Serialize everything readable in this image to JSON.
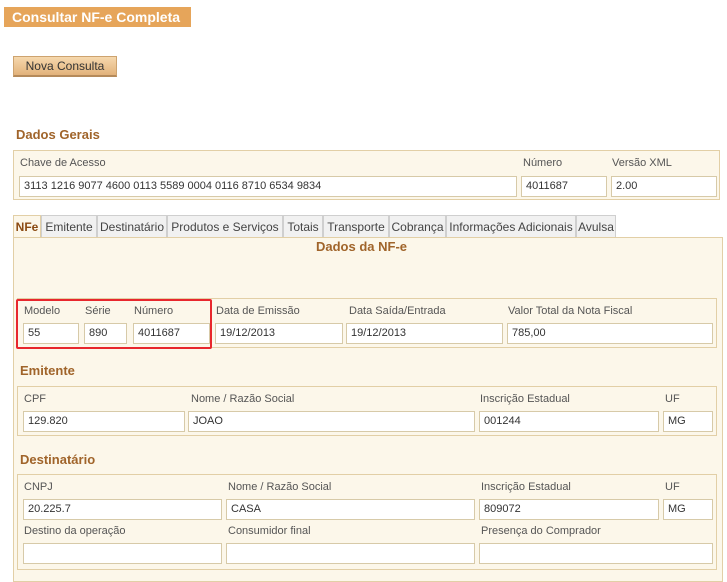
{
  "header": {
    "title": "Consultar NF-e Completa",
    "new_query_button": "Nova Consulta"
  },
  "dados_gerais": {
    "title": "Dados Gerais",
    "chave_label": "Chave de Acesso",
    "chave_value": "3113 1216 9077 4600 0113 5589 0004 0116 8710 6534 9834",
    "numero_label": "Número",
    "numero_value": "4011687",
    "versao_label": "Versão XML",
    "versao_value": "2.00"
  },
  "tabs": [
    {
      "label": "NFe"
    },
    {
      "label": "Emitente"
    },
    {
      "label": "Destinatário"
    },
    {
      "label": "Produtos e Serviços"
    },
    {
      "label": "Totais"
    },
    {
      "label": "Transporte"
    },
    {
      "label": "Cobrança"
    },
    {
      "label": "Informações Adicionais"
    },
    {
      "label": "Avulsa"
    }
  ],
  "nfe": {
    "title": "Dados da NF-e",
    "modelo_label": "Modelo",
    "modelo_value": "55",
    "serie_label": "Série",
    "serie_value": "890",
    "numero_label": "Número",
    "numero_value": "4011687",
    "emissao_label": "Data de Emissão",
    "emissao_value": "19/12/2013",
    "saida_label": "Data Saída/Entrada",
    "saida_value": "19/12/2013",
    "valor_label": "Valor Total da Nota Fiscal",
    "valor_value": "785,00"
  },
  "emitente": {
    "title": "Emitente",
    "cpf_label": "CPF",
    "cpf_value": "129.820",
    "nome_label": "Nome / Razão Social",
    "nome_value": "JOAO",
    "ie_label": "Inscrição Estadual",
    "ie_value": "001244",
    "uf_label": "UF",
    "uf_value": "MG"
  },
  "destinatario": {
    "title": "Destinatário",
    "cnpj_label": "CNPJ",
    "cnpj_value": "20.225.7",
    "nome_label": "Nome / Razão Social",
    "nome_value": "CASA",
    "ie_label": "Inscrição Estadual",
    "ie_value": "809072",
    "uf_label": "UF",
    "uf_value": "MG",
    "destino_label": "Destino da operação",
    "destino_value": "",
    "consumidor_label": "Consumidor final",
    "consumidor_value": "",
    "presenca_label": "Presença do Comprador",
    "presenca_value": ""
  }
}
